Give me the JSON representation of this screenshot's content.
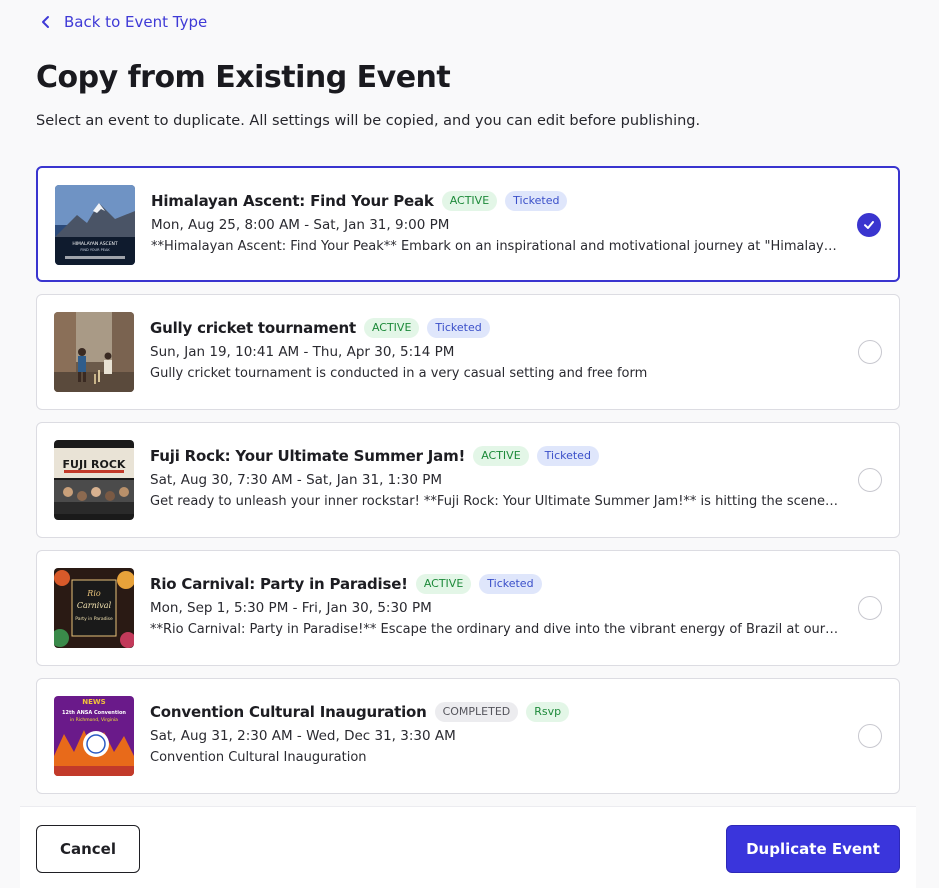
{
  "nav": {
    "back_label": "Back to Event Type"
  },
  "header": {
    "title": "Copy from Existing Event",
    "subtitle": "Select an event to duplicate. All settings will be copied, and you can edit before publishing."
  },
  "events": [
    {
      "title": "Himalayan Ascent: Find Your Peak",
      "status": "ACTIVE",
      "type": "Ticketed",
      "dates": "Mon, Aug 25, 8:00 AM - Sat, Jan 31, 9:00 PM",
      "description": "**Himalayan Ascent: Find Your Peak** Embark on an inspirational and motivational journey at \"Himalayan Ascent: Find Your Peak\"",
      "selected": true
    },
    {
      "title": "Gully cricket tournament",
      "status": "ACTIVE",
      "type": "Ticketed",
      "dates": "Sun, Jan 19, 10:41 AM - Thu, Apr 30, 5:14 PM",
      "description": "Gully cricket tournament is conducted in a very casual setting and free form",
      "selected": false
    },
    {
      "title": "Fuji Rock: Your Ultimate Summer Jam!",
      "status": "ACTIVE",
      "type": "Ticketed",
      "dates": "Sat, Aug 30, 7:30 AM - Sat, Jan 31, 1:30 PM",
      "description": "Get ready to unleash your inner rockstar! **Fuji Rock: Your Ultimate Summer Jam!** is hitting the scene this summer",
      "selected": false
    },
    {
      "title": "Rio Carnival: Party in Paradise!",
      "status": "ACTIVE",
      "type": "Ticketed",
      "dates": "Mon, Sep 1, 5:30 PM - Fri, Jan 30, 5:30 PM",
      "description": "**Rio Carnival: Party in Paradise!** Escape the ordinary and dive into the vibrant energy of Brazil at our festival",
      "selected": false
    },
    {
      "title": "Convention Cultural Inauguration",
      "status": "COMPLETED",
      "type": "Rsvp",
      "dates": "Sat, Aug 31, 2:30 AM - Wed, Dec 31, 3:30 AM",
      "description": "Convention Cultural Inauguration",
      "selected": false
    }
  ],
  "thumbnails": {
    "himalayan": {
      "text1": "HIMALAYAN ASCENT",
      "text2": "FIND YOUR PEAK"
    },
    "fuji": {
      "text1": "FUJI ROCK"
    },
    "rio": {
      "text1": "Rio",
      "text2": "Carnival",
      "text3": "Party in Paradise"
    },
    "convention": {
      "text1": "NEWS",
      "text2": "12th ANSA Convention",
      "text3": "in Richmond, Virginia"
    }
  },
  "footer": {
    "cancel_label": "Cancel",
    "duplicate_label": "Duplicate Event"
  },
  "colors": {
    "accent": "#3a35dc",
    "active_green": "#1d8a3a",
    "ticketed_blue": "#3a4fc9"
  }
}
